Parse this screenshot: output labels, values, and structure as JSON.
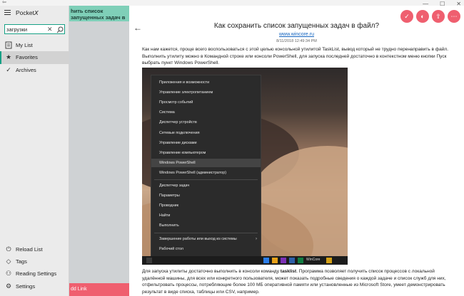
{
  "window": {
    "back_glyph": "⇦",
    "minimize": "—",
    "maximize": "☐",
    "close": "✕"
  },
  "sidebar": {
    "app_name": "Pocket𝘟",
    "search": {
      "value": "загрузки",
      "clear": "✕"
    },
    "items": [
      {
        "label": "My List",
        "icon": "list-icon"
      },
      {
        "label": "Favorites",
        "icon": "star-icon",
        "active": true
      },
      {
        "label": "Archives",
        "icon": "check-icon"
      }
    ],
    "bottom_items": [
      {
        "label": "Reload List",
        "icon": "power-icon"
      },
      {
        "label": "Tags",
        "icon": "tag-icon"
      },
      {
        "label": "Reading Settings",
        "icon": "people-icon"
      },
      {
        "label": "Settings",
        "icon": "gear-icon"
      }
    ]
  },
  "list": {
    "card_title": "hить список запущенных задач в файл?",
    "add_link": "dd Link"
  },
  "article": {
    "back": "←",
    "actions": [
      "✓",
      "◐",
      "⇪",
      "⋯"
    ],
    "title": "Как сохранить список запущенных задач в файл?",
    "source": "www.wincore.ru",
    "date": "8/11/2018 12:49:34 PM",
    "intro": "Как нам кажется, проще всего воспользоваться с этой целью консольной утилитой TaskList, вывод который не трудно перенаправить в файл. Выполнить утилиту можно в Командной строке или консоли PowerShell, для запуска последней достаточно в контекстном меню кнопки Пуск выбрать пункт Windows PowerShell.",
    "para2_before": "Для запуска утилиты достаточно выполнить в консоли команду ",
    "para2_bold": "tasklist",
    "para2_after": ". Программа позволяет получить список процессов с локальной удалённой машины, для всех или конкретного пользователя, может показать подробные сведения о каждой задаче и список служб для них, отфильтровать процессы, потребляющие более 100 МБ оперативной памяти или установленные из Microsoft Store, умеет демонстрировать результат в виде списка, таблицы или CSV, например.",
    "menu": [
      "Приложения и возможности",
      "Управление электропитанием",
      "Просмотр событий",
      "Система",
      "Диспетчер устройств",
      "Сетевые подключения",
      "Управление дисками",
      "Управление компьютером",
      "Windows PowerShell",
      "Windows PowerShell (администратор)",
      "Диспетчер задач",
      "Параметры",
      "Проводник",
      "Найти",
      "Выполнить",
      "Завершение работы или выход из системы",
      "Рабочий стол"
    ],
    "menu_highlight_index": 8,
    "taskbar_text": "WinCore"
  },
  "colors": {
    "accent": "#16a085",
    "action": "#ef5f6f",
    "teal_card": "#7fcfb8"
  }
}
